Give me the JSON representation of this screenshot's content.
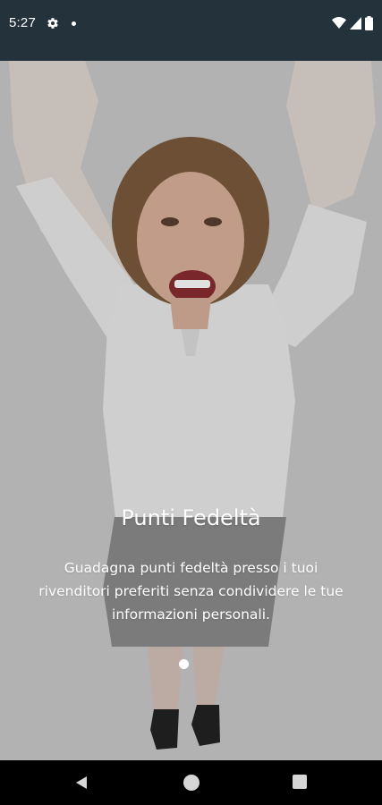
{
  "status_bar": {
    "time": "5:27",
    "icons": [
      "settings-icon",
      "notification-dot-icon",
      "wifi-icon",
      "cellular-icon",
      "battery-icon"
    ]
  },
  "slide": {
    "title": "Punti Fedeltà",
    "description": "Guadagna punti fedeltà presso i tuoi rivenditori preferiti senza condividere le tue informazioni personali.",
    "page_index": 1,
    "page_count": 1,
    "image": "happy-woman-photo"
  },
  "nav_bar": {
    "buttons": [
      "back-icon",
      "home-icon",
      "recents-icon"
    ]
  },
  "colors": {
    "status_bar_bg": "#24323c",
    "nav_bar_bg": "#000000",
    "overlay_text": "#ffffff"
  }
}
